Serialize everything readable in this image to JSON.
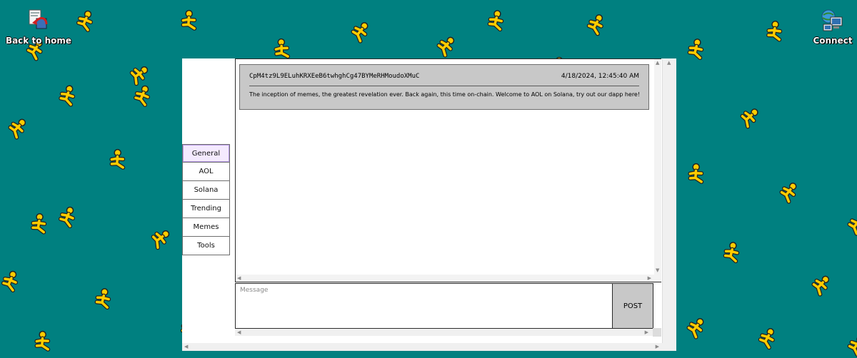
{
  "desktop": {
    "back_home": {
      "label": "Back to home",
      "icon": "back-home-icon"
    },
    "connect": {
      "label": "Connect",
      "icon": "network-connect-icon"
    },
    "background": {
      "color": "#008080",
      "pattern": "aol-running-man"
    }
  },
  "tabs": [
    {
      "label": "General",
      "active": true
    },
    {
      "label": "AOL",
      "active": false
    },
    {
      "label": "Solana",
      "active": false
    },
    {
      "label": "Trending",
      "active": false
    },
    {
      "label": "Memes",
      "active": false
    },
    {
      "label": "Tools",
      "active": false
    }
  ],
  "chat": {
    "messages": [
      {
        "author": "CpM4tz9L9ELuhKRXEeB6twhghCg47BYMeRHMoudoXMuC",
        "timestamp": "4/18/2024, 12:45:40 AM",
        "text": "The inception of memes, the greatest revelation ever. Back again, this time on-chain. Welcome to AOL on Solana, try out our dapp here!"
      }
    ]
  },
  "composer": {
    "placeholder": "Message",
    "value": "",
    "post_label": "POST"
  },
  "colors": {
    "desktop_bg": "#008080",
    "runner_yellow": "#ffcc00",
    "message_bg": "#c8c8c8",
    "active_tab_bg": "#f4eaff"
  }
}
